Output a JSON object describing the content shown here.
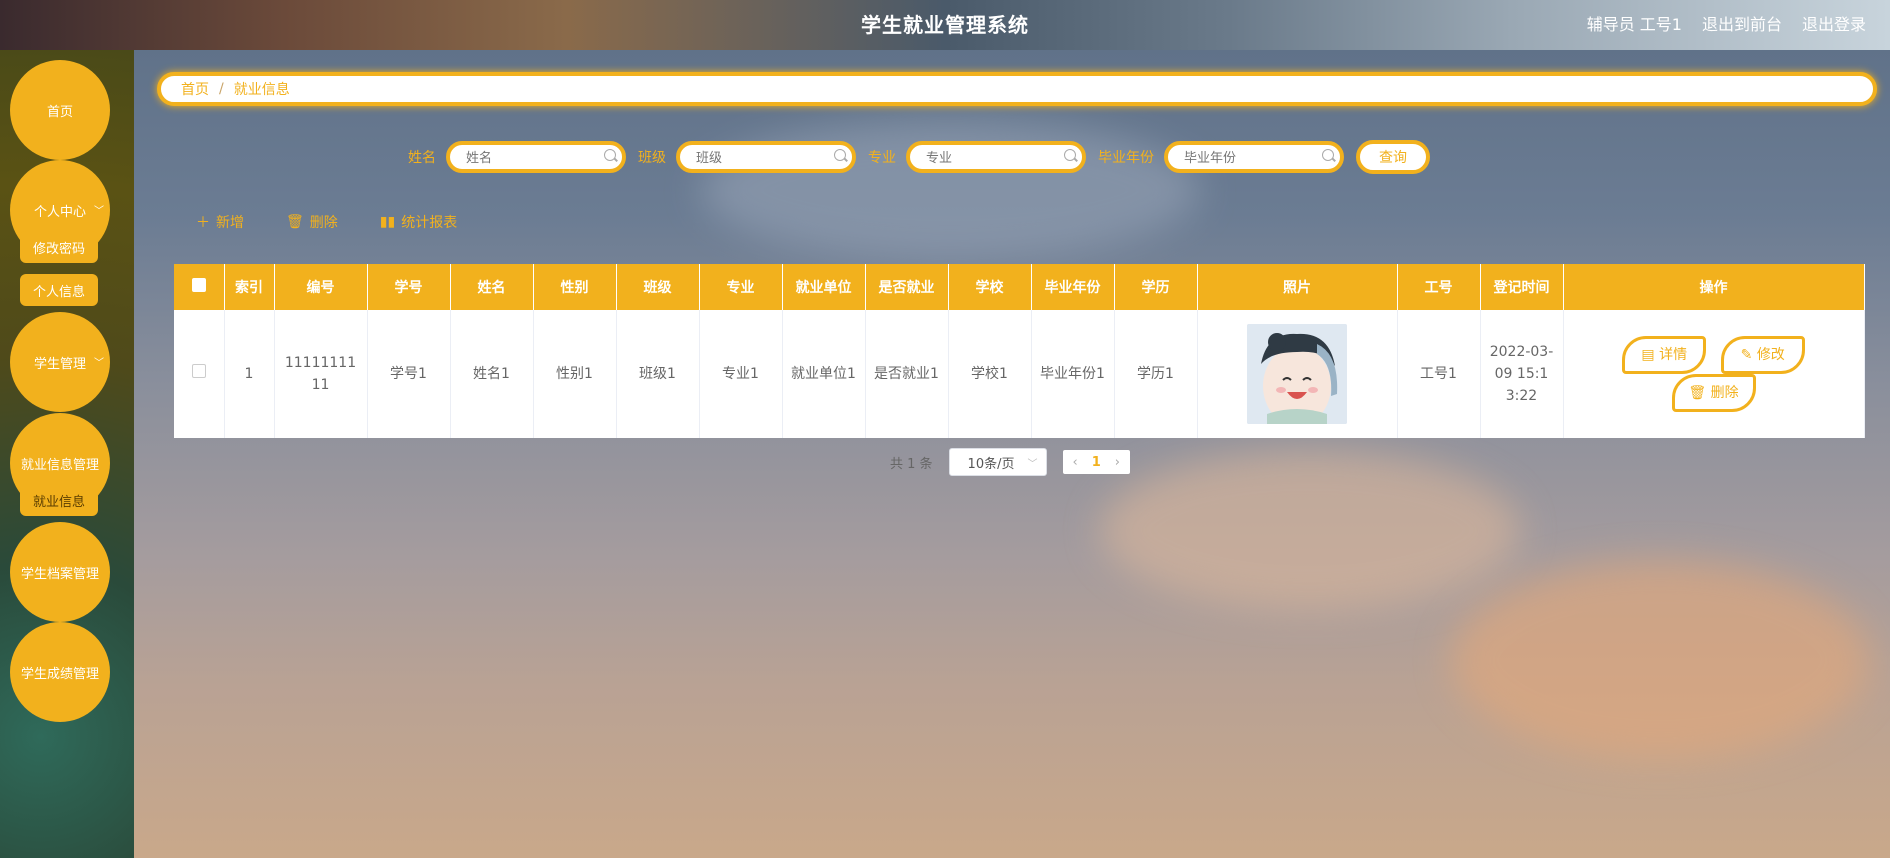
{
  "header": {
    "title": "学生就业管理系统",
    "role": "辅导员 工号1",
    "to_front": "退出到前台",
    "logout": "退出登录"
  },
  "sidebar": {
    "home": "首页",
    "personal": "个人中心",
    "change_pwd": "修改密码",
    "personal_info": "个人信息",
    "student_mgmt": "学生管理",
    "employment_mgmt": "就业信息管理",
    "employment_info": "就业信息",
    "archive_mgmt": "学生档案管理",
    "score_mgmt": "学生成绩管理"
  },
  "breadcrumb": {
    "home": "首页",
    "separator": "/",
    "current": "就业信息"
  },
  "search": {
    "name_label": "姓名",
    "name_placeholder": "姓名",
    "class_label": "班级",
    "class_placeholder": "班级",
    "major_label": "专业",
    "major_placeholder": "专业",
    "year_label": "毕业年份",
    "year_placeholder": "毕业年份",
    "query": "查询"
  },
  "actions": {
    "add": "新增",
    "delete": "删除",
    "report": "统计报表"
  },
  "table": {
    "headers": [
      "索引",
      "编号",
      "学号",
      "姓名",
      "性别",
      "班级",
      "专业",
      "就业单位",
      "是否就业",
      "学校",
      "毕业年份",
      "学历",
      "照片",
      "工号",
      "登记时间",
      "操作"
    ],
    "rows": [
      {
        "index": "1",
        "code": "1111111111",
        "student_no": "学号1",
        "name": "姓名1",
        "gender": "性别1",
        "class": "班级1",
        "major": "专业1",
        "employer": "就业单位1",
        "employed": "是否就业1",
        "school": "学校1",
        "grad_year": "毕业年份1",
        "degree": "学历1",
        "staff_no": "工号1",
        "reg_time": "2022-03-09 15:13:22"
      }
    ],
    "op_detail": "详情",
    "op_edit": "修改",
    "op_delete": "删除"
  },
  "pager": {
    "total": "共 1 条",
    "page_size": "10条/页",
    "current_page": "1"
  },
  "colors": {
    "accent": "#f2b11d"
  }
}
